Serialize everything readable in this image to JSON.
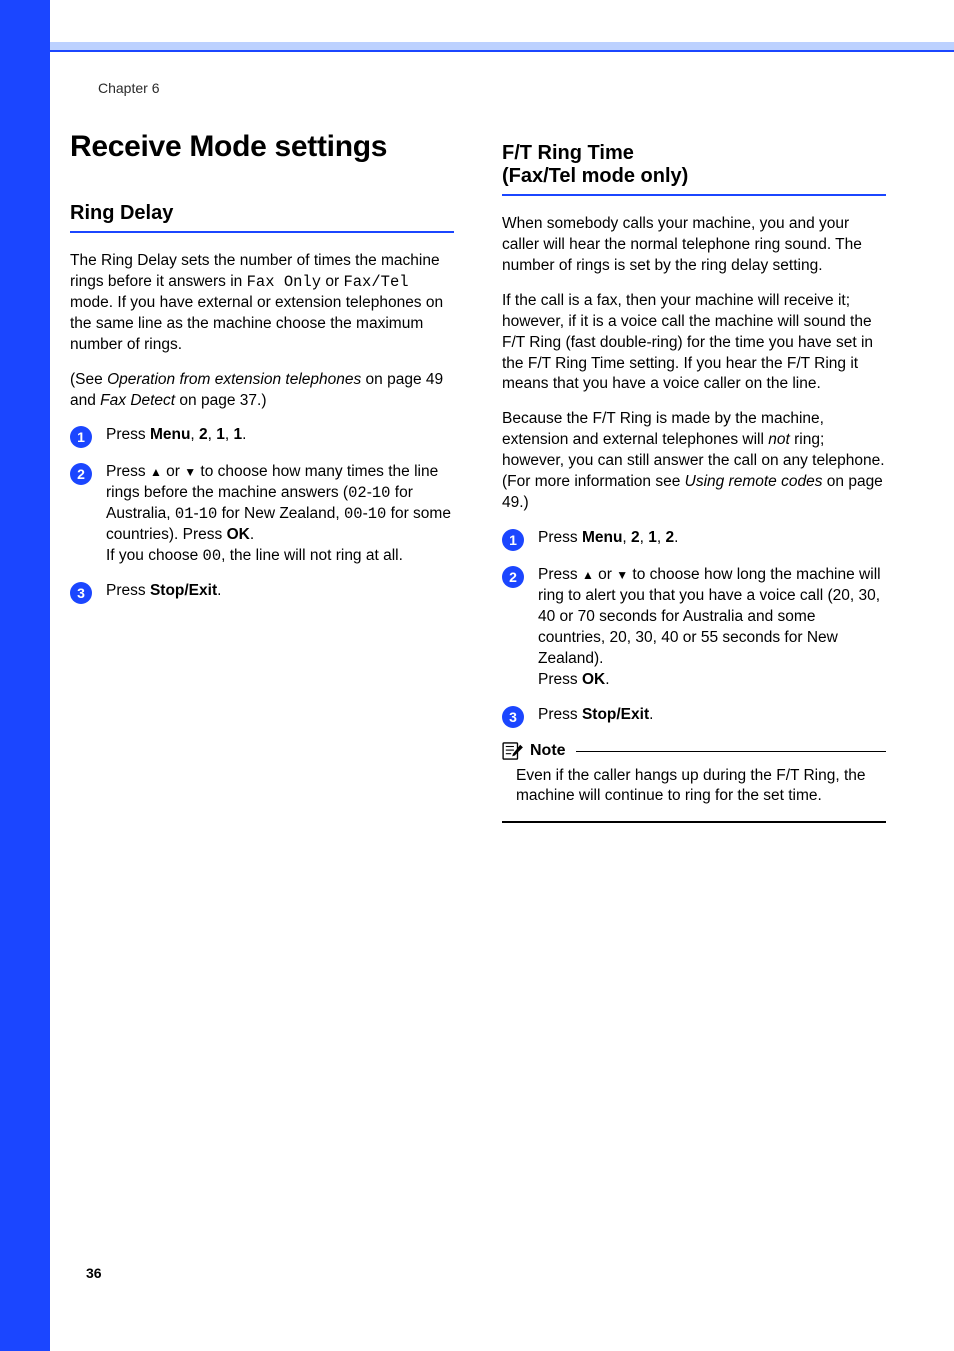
{
  "chapter": "Chapter 6",
  "page_number": "36",
  "left": {
    "h1": "Receive Mode settings",
    "h2": "Ring Delay",
    "p1_a": "The Ring Delay sets the number of times the machine rings before it answers in ",
    "p1_mono1": "Fax Only",
    "p1_b": " or ",
    "p1_mono2": "Fax/Tel",
    "p1_c": " mode. If you have external or extension telephones on the same line as the machine choose the maximum number of rings.",
    "p2_a": "(See ",
    "p2_em1": "Operation from extension telephones",
    "p2_b": " on page 49 and ",
    "p2_em2": "Fax Detect",
    "p2_c": " on page 37.)",
    "step1_a": "Press ",
    "step1_menu": "Menu",
    "step1_b": ", ",
    "step1_n1": "2",
    "step1_c": ", ",
    "step1_n2": "1",
    "step1_d": ", ",
    "step1_n3": "1",
    "step1_e": ".",
    "step2_a": "Press ",
    "step2_up": "▲",
    "step2_b": " or ",
    "step2_down": "▼",
    "step2_c": " to choose how many times the line rings before the machine answers (",
    "step2_m1": "02",
    "step2_d": "-",
    "step2_m2": "10",
    "step2_e": " for Australia, ",
    "step2_m3": "01",
    "step2_f": "-",
    "step2_m4": "10",
    "step2_g": " for New Zealand, ",
    "step2_m5": "00",
    "step2_h": "-",
    "step2_m6": "10",
    "step2_i": " for some countries). Press ",
    "step2_ok": "OK",
    "step2_j": ".",
    "step2_k": "If you choose ",
    "step2_m7": "00",
    "step2_l": ", the line will not ring at all.",
    "step3_a": "Press ",
    "step3_stop": "Stop/Exit",
    "step3_b": "."
  },
  "right": {
    "h2_line1": "F/T Ring Time",
    "h2_line2": "(Fax/Tel mode only)",
    "p1": "When somebody calls your machine, you and your caller will hear the normal telephone ring sound. The number of rings is set by the ring delay setting.",
    "p2": "If the call is a fax, then your machine will receive it; however, if it is a voice call the machine will sound the F/T Ring (fast double-ring) for the time you have set in the F/T Ring Time setting. If you hear the F/T Ring it means that you have a voice caller on the line.",
    "p3_a": "Because the F/T Ring is made by the machine, extension and external telephones will ",
    "p3_em": "not",
    "p3_b": " ring; however, you can still answer the call on any telephone. (For more information see ",
    "p3_em2": "Using remote codes",
    "p3_c": " on page 49.)",
    "step1_a": "Press ",
    "step1_menu": "Menu",
    "step1_b": ", ",
    "step1_n1": "2",
    "step1_c": ", ",
    "step1_n2": "1",
    "step1_d": ", ",
    "step1_n3": "2",
    "step1_e": ".",
    "step2_a": "Press ",
    "step2_up": "▲",
    "step2_b": " or ",
    "step2_down": "▼",
    "step2_c": " to choose how long the machine will ring to alert you that you have a voice call (20, 30, 40 or 70 seconds for Australia and some countries, 20, 30, 40 or 55 seconds for New Zealand).",
    "step2_d": "Press ",
    "step2_ok": "OK",
    "step2_e": ".",
    "step3_a": "Press ",
    "step3_stop": "Stop/Exit",
    "step3_b": ".",
    "note_title": "Note",
    "note_body": "Even if the caller hangs up during the F/T Ring, the machine will continue to ring for the set time."
  },
  "badges": {
    "n1": "1",
    "n2": "2",
    "n3": "3"
  }
}
